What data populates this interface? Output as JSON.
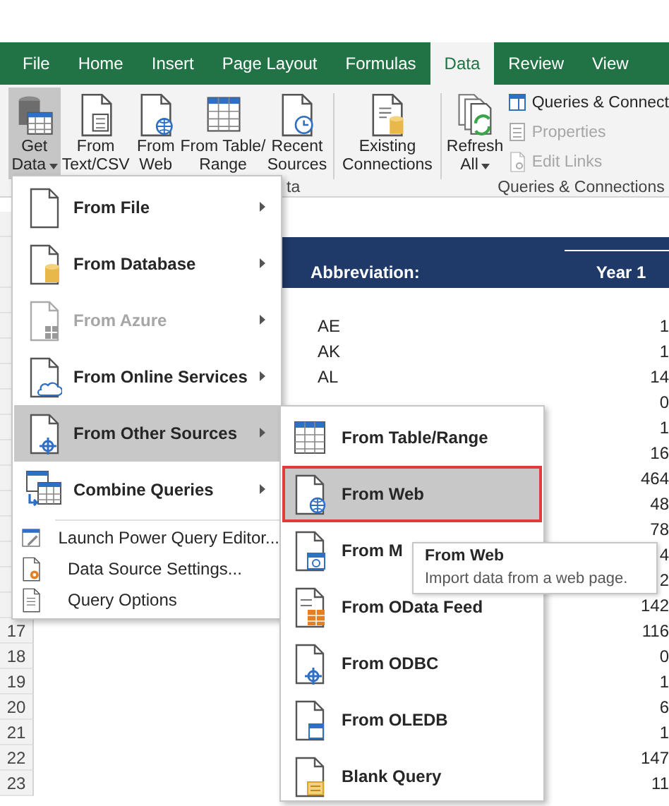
{
  "ribbon_tabs": [
    {
      "label": "File",
      "selected": false
    },
    {
      "label": "Home",
      "selected": false
    },
    {
      "label": "Insert",
      "selected": false
    },
    {
      "label": "Page Layout",
      "selected": false
    },
    {
      "label": "Formulas",
      "selected": false
    },
    {
      "label": "Data",
      "selected": true
    },
    {
      "label": "Review",
      "selected": false
    },
    {
      "label": "View",
      "selected": false
    }
  ],
  "ribbon": {
    "buttons": [
      {
        "lines": [
          "Get",
          "Data"
        ],
        "pressed": true,
        "dropdown": true,
        "divider_before": false
      },
      {
        "lines": [
          "From",
          "Text/CSV"
        ],
        "pressed": false,
        "dropdown": false,
        "divider_before": false
      },
      {
        "lines": [
          "From",
          "Web"
        ],
        "pressed": false,
        "dropdown": false,
        "divider_before": false
      },
      {
        "lines": [
          "From Table/",
          "Range"
        ],
        "pressed": false,
        "dropdown": false,
        "divider_before": false
      },
      {
        "lines": [
          "Recent",
          "Sources"
        ],
        "pressed": false,
        "dropdown": false,
        "divider_before": false
      },
      {
        "lines": [
          "Existing",
          "Connections"
        ],
        "pressed": false,
        "dropdown": false,
        "divider_before": true
      },
      {
        "lines": [
          "Refresh",
          "All"
        ],
        "pressed": false,
        "dropdown": true,
        "divider_before": true
      }
    ],
    "small_buttons": [
      {
        "label": "Queries & Connect",
        "disabled": false
      },
      {
        "label": "Properties",
        "disabled": true
      },
      {
        "label": "Edit Links",
        "disabled": true
      }
    ],
    "group_labels": [
      "ta",
      "Queries & Connections"
    ]
  },
  "sheet": {
    "header": {
      "abbreviation": "Abbreviation:",
      "year": "Year 1"
    },
    "rows": [
      {
        "abbreviation": "AE",
        "value": "1"
      },
      {
        "abbreviation": "AK",
        "value": "1"
      },
      {
        "abbreviation": "AL",
        "value": "14"
      },
      {
        "value": "0"
      },
      {
        "value": "1"
      },
      {
        "value": "16"
      },
      {
        "value": "464"
      },
      {
        "value": "48"
      },
      {
        "value": "78"
      },
      {
        "value": "4"
      },
      {
        "value": "2"
      },
      {
        "value": "142"
      },
      {
        "number": "17",
        "value": "116"
      },
      {
        "number": "18",
        "value": "0"
      },
      {
        "number": "19",
        "value": "1"
      },
      {
        "number": "20",
        "value": "6"
      },
      {
        "number": "21",
        "value": "1"
      },
      {
        "number": "22",
        "value": "147"
      },
      {
        "number": "23",
        "value": "11"
      }
    ]
  },
  "get_data_menu": {
    "items": [
      {
        "label": "From File",
        "kind": "large",
        "submenu": true,
        "disabled": false,
        "selected": false
      },
      {
        "label": "From Database",
        "kind": "large",
        "submenu": true,
        "disabled": false,
        "selected": false
      },
      {
        "label": "From Azure",
        "kind": "large",
        "submenu": true,
        "disabled": true,
        "selected": false
      },
      {
        "label": "From Online Services",
        "kind": "large",
        "submenu": true,
        "disabled": false,
        "selected": false
      },
      {
        "label": "From Other Sources",
        "kind": "large",
        "submenu": true,
        "disabled": false,
        "selected": true
      },
      {
        "label": "Combine Queries",
        "kind": "large",
        "submenu": true,
        "disabled": false,
        "selected": false
      },
      {
        "label": "Launch Power Query Editor...",
        "kind": "small",
        "submenu": false,
        "disabled": false,
        "selected": false
      },
      {
        "label": "Data Source Settings...",
        "kind": "small",
        "submenu": false,
        "disabled": false,
        "selected": false
      },
      {
        "label": "Query Options",
        "kind": "small",
        "submenu": false,
        "disabled": false,
        "selected": false
      }
    ]
  },
  "other_sources_menu": {
    "items": [
      {
        "label": "From Table/Range",
        "selected": false
      },
      {
        "label": "From Web",
        "selected": true
      },
      {
        "label": "From M",
        "selected": false
      },
      {
        "label": "From OData Feed",
        "selected": false
      },
      {
        "label": "From ODBC",
        "selected": false
      },
      {
        "label": "From OLEDB",
        "selected": false
      },
      {
        "label": "Blank Query",
        "selected": false
      }
    ]
  },
  "tooltip": {
    "title": "From Web",
    "text": "Import data from a web page."
  }
}
